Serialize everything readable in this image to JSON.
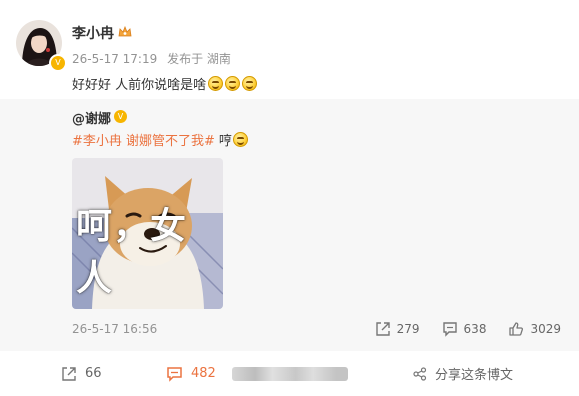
{
  "post": {
    "author": {
      "name": "李小冉"
    },
    "meta": {
      "time": "26-5-17 17:19",
      "location": "发布于 湖南"
    },
    "text": "好好好 人前你说啥是啥",
    "emoji_count": 3
  },
  "repost": {
    "author": "@谢娜",
    "hashtag": "#李小冉 谢娜管不了我#",
    "text": "哼",
    "image_caption": "呵，女人",
    "time": "26-5-17 16:56",
    "stats": {
      "reposts": "279",
      "comments": "638",
      "likes": "3029"
    }
  },
  "actions": {
    "repost_count": "66",
    "comment_count": "482",
    "share_label": "分享这条博文"
  },
  "colors": {
    "hashtag": "#eb7340",
    "active_comment": "#eb7340",
    "repost_bg": "#f7f7f7",
    "meta_text": "#939393"
  },
  "icons": {
    "crown": "crown-icon",
    "verified": "verified-badge-icon",
    "repost": "repost-icon",
    "comment": "comment-icon",
    "like": "thumbs-up-icon",
    "share": "share-icon"
  }
}
